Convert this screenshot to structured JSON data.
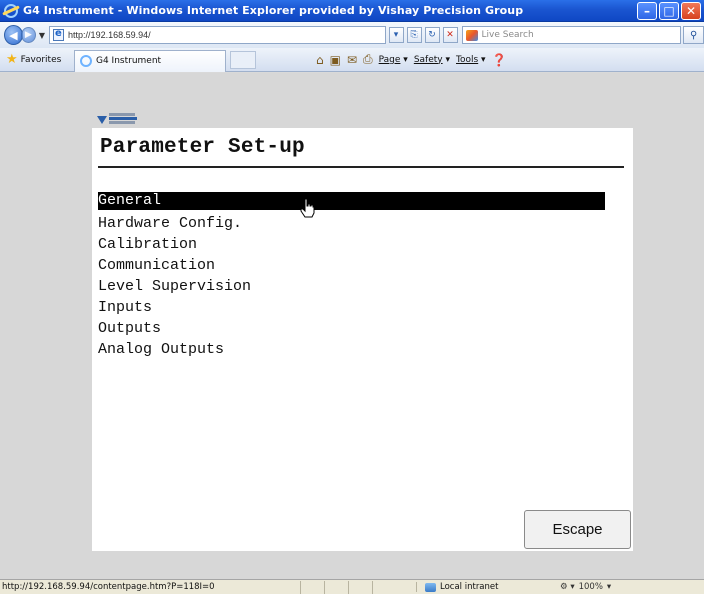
{
  "window": {
    "title": "G4 Instrument - Windows Internet Explorer provided by Vishay Precision Group",
    "minimize": "–",
    "maximize": "□",
    "close": "✕"
  },
  "address_bar": {
    "url": "http://192.168.59.94/",
    "search_placeholder": "Live Search"
  },
  "favorites_bar": {
    "favorites_label": "Favorites",
    "tab_title": "G4 Instrument",
    "commands": {
      "page": "Page",
      "safety": "Safety",
      "tools": "Tools"
    }
  },
  "page": {
    "title": "Parameter Set-up",
    "menu": [
      {
        "label": "General",
        "selected": true
      },
      {
        "label": "Hardware Config."
      },
      {
        "label": "Calibration"
      },
      {
        "label": "Communication"
      },
      {
        "label": "Level Supervision"
      },
      {
        "label": "Inputs"
      },
      {
        "label": "Outputs"
      },
      {
        "label": "Analog Outputs"
      }
    ],
    "escape_label": "Escape"
  },
  "status_bar": {
    "url": "http://192.168.59.94/contentpage.htm?P=118I=0",
    "zone": "Local intranet",
    "zoom": "100%"
  },
  "icons": [
    "ie-logo-icon",
    "back-icon",
    "forward-icon",
    "refresh-icon",
    "stop-icon",
    "search-icon",
    "favorites-star-icon",
    "home-icon",
    "feeds-icon",
    "mail-icon",
    "print-icon",
    "help-icon",
    "hand-cursor-icon",
    "globe-icon"
  ]
}
